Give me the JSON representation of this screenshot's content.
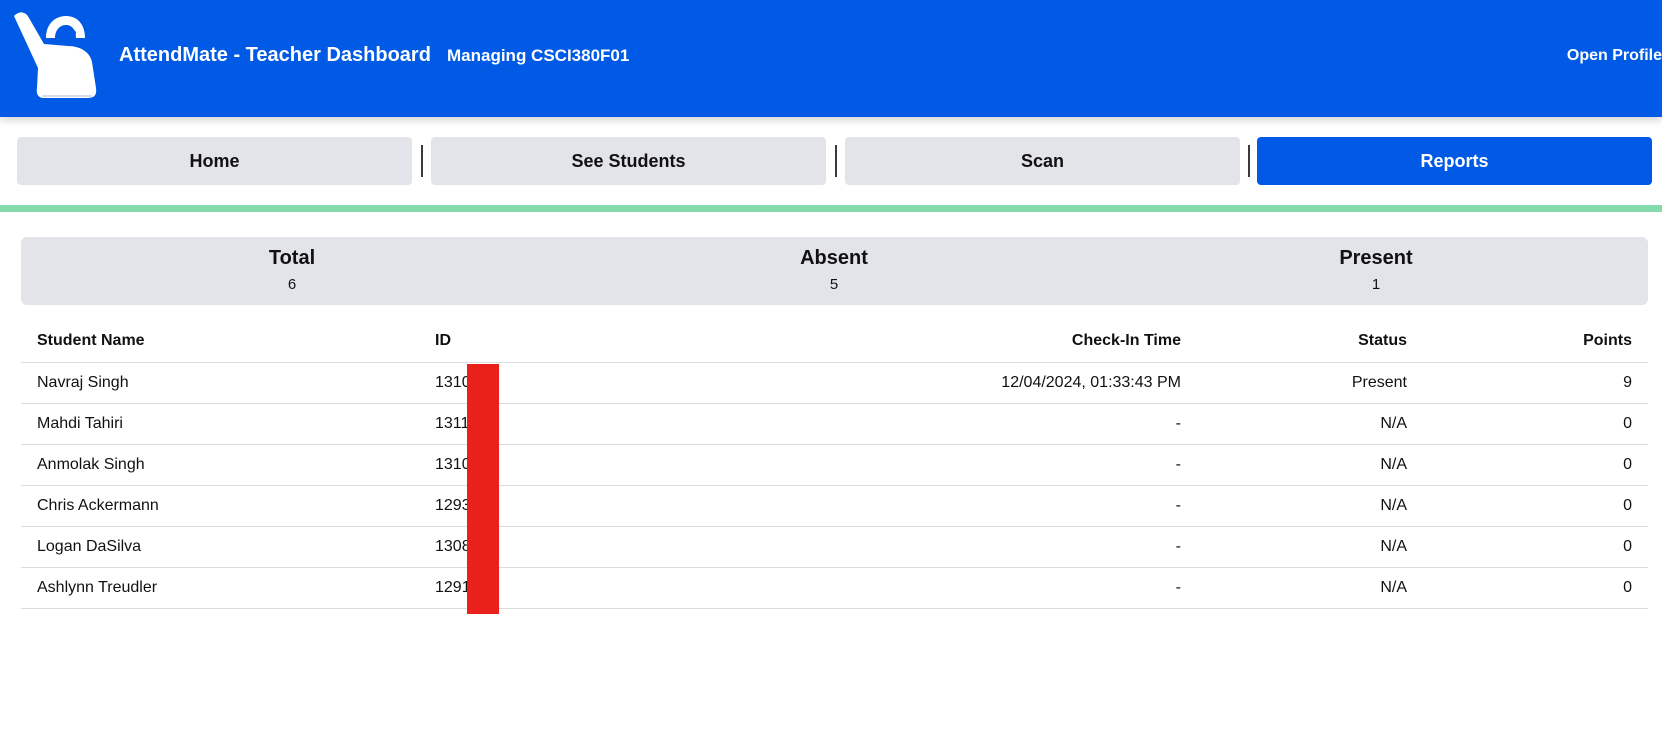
{
  "header": {
    "app_title": "AttendMate - Teacher Dashboard",
    "course": "Managing CSCI380F01",
    "profile_label": "Open Profile",
    "logo_icon": "raised-hand-icon"
  },
  "nav": {
    "home": "Home",
    "students": "See Students",
    "scan": "Scan",
    "reports": "Reports",
    "active": "Reports"
  },
  "summary": {
    "total": {
      "label": "Total",
      "value": "6"
    },
    "absent": {
      "label": "Absent",
      "value": "5"
    },
    "present": {
      "label": "Present",
      "value": "1"
    }
  },
  "table": {
    "columns": [
      "Student Name",
      "ID",
      "Check-In Time",
      "Status",
      "Points"
    ],
    "rows": [
      {
        "name": "Navraj Singh",
        "id": "1310",
        "time": "12/04/2024, 01:33:43 PM",
        "status": "Present",
        "points": "9"
      },
      {
        "name": "Mahdi Tahiri",
        "id": "1311",
        "time": "-",
        "status": "N/A",
        "points": "0"
      },
      {
        "name": "Anmolak Singh",
        "id": "1310",
        "time": "-",
        "status": "N/A",
        "points": "0"
      },
      {
        "name": "Chris Ackermann",
        "id": "1293",
        "time": "-",
        "status": "N/A",
        "points": "0"
      },
      {
        "name": "Logan DaSilva",
        "id": "1308",
        "time": "-",
        "status": "N/A",
        "points": "0"
      },
      {
        "name": "Ashlynn Treudler",
        "id": "1291",
        "time": "-",
        "status": "N/A",
        "points": "0"
      }
    ]
  },
  "colors": {
    "brand": "#005ae6",
    "divider": "#86dbac",
    "panel": "#e2e4e9",
    "redaction": "#ea211a"
  }
}
